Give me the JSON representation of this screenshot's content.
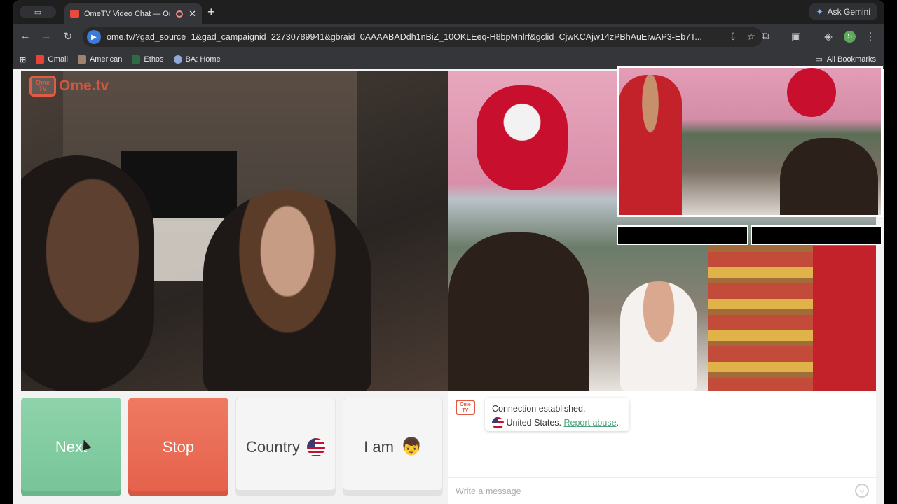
{
  "browser": {
    "tab_title": "OmeTV Video Chat — Om",
    "tab_close": "✕",
    "new_tab": "+",
    "ask_gemini": "Ask Gemini",
    "url": "ome.tv/?gad_source=1&gad_campaignid=22730789941&gbraid=0AAAABADdh1nBiZ_10OKLEeq-H8bpMnlrf&gclid=CjwKCAjw14zPBhAuEiwAP3-Eb7T...",
    "profile_initial": "S"
  },
  "bookmarks": {
    "items": [
      "Gmail",
      "American",
      "Ethos",
      "BA: Home"
    ],
    "all": "All Bookmarks"
  },
  "page": {
    "logo_box": "Ome TV",
    "logo_text": "Ome.tv",
    "buttons": {
      "next": "Next",
      "stop": "Stop",
      "country": "Country",
      "iam": "I am"
    },
    "chat": {
      "logo": "Ome TV",
      "line1": "Connection established.",
      "country": "United States.",
      "report": "Report abuse",
      "placeholder": "Write a message"
    }
  },
  "icons": {
    "accent_green": "#76c497",
    "accent_red": "#e5604a",
    "brand": "#e15a44"
  }
}
